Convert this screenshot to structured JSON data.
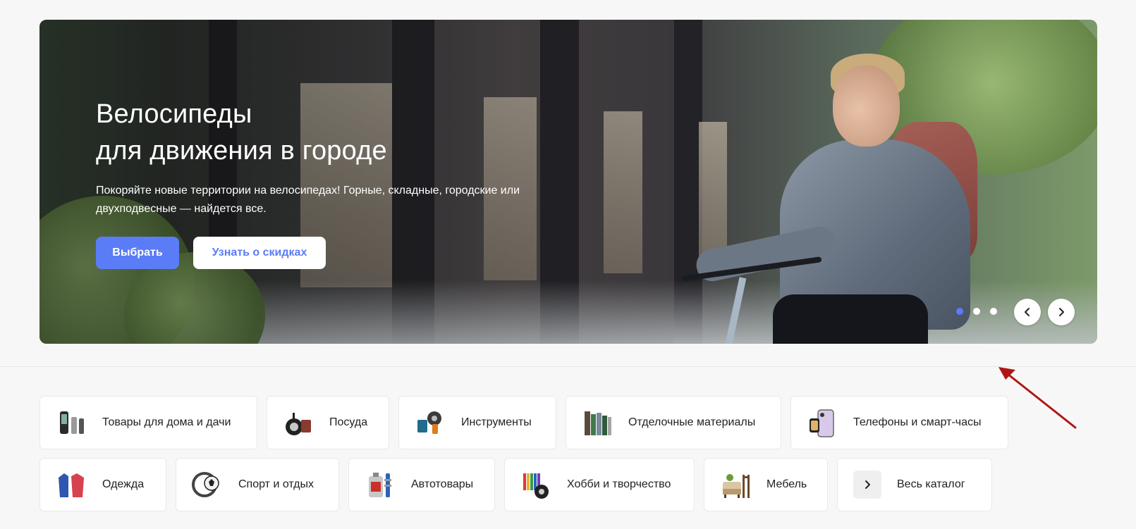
{
  "hero": {
    "title_line1": "Велосипеды",
    "title_line2": "для движения в городе",
    "description": "Покоряйте новые территории на велосипедах! Горные, складные, городские или двухподвесные — найдется все.",
    "primary_button": "Выбрать",
    "secondary_button": "Узнать о скидках",
    "slide_count": 3,
    "active_slide": 1,
    "prev_icon": "‹",
    "next_icon": "›",
    "accent_color": "#5b7cf7"
  },
  "categories": {
    "row1": [
      {
        "label": "Товары для дома и дачи",
        "icon": "home-appliances-icon"
      },
      {
        "label": "Посуда",
        "icon": "cookware-icon"
      },
      {
        "label": "Инструменты",
        "icon": "tools-icon"
      },
      {
        "label": "Отделочные материалы",
        "icon": "finishing-materials-icon"
      },
      {
        "label": "Телефоны и смарт-часы",
        "icon": "phones-icon"
      }
    ],
    "row2": [
      {
        "label": "Одежда",
        "icon": "clothing-icon"
      },
      {
        "label": "Спорт и отдых",
        "icon": "sport-icon"
      },
      {
        "label": "Автотовары",
        "icon": "auto-goods-icon"
      },
      {
        "label": "Хобби и творчество",
        "icon": "hobby-icon"
      },
      {
        "label": "Мебель",
        "icon": "furniture-icon"
      }
    ],
    "all_catalog": {
      "label": "Весь каталог",
      "icon": "›"
    }
  }
}
